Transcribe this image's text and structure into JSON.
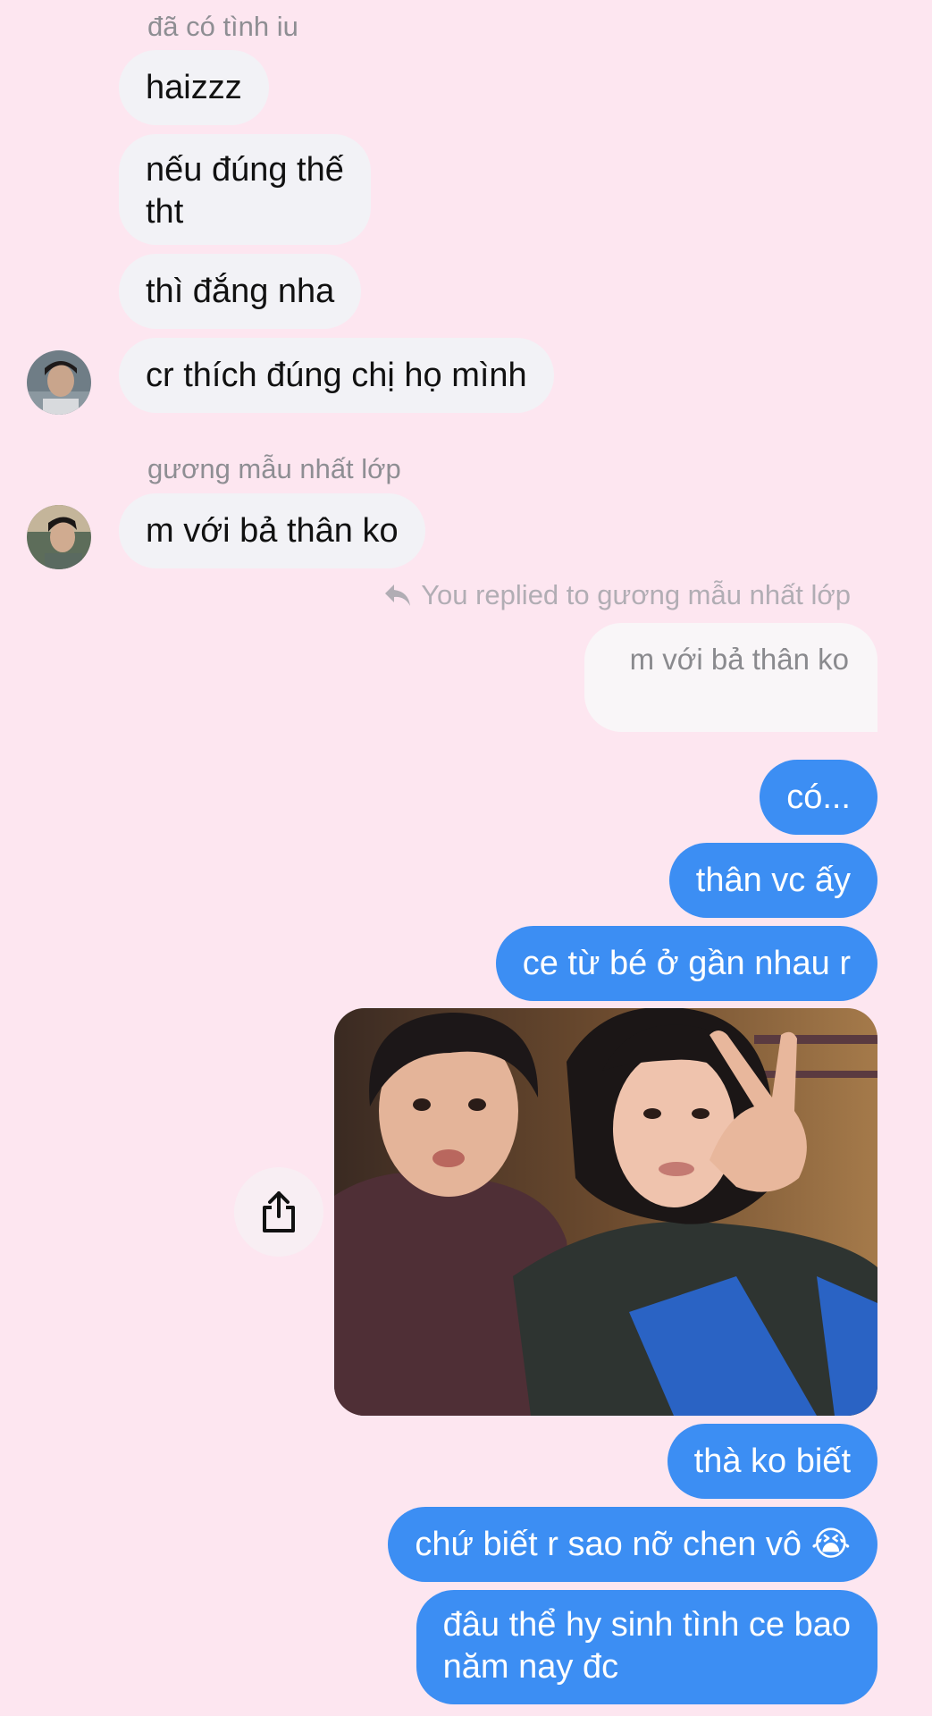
{
  "conversation": {
    "group_a": {
      "sender": "đã có tình iu",
      "messages": [
        "haizzz",
        "nếu đúng thế\ntht",
        "thì đắng nha",
        "cr thích đúng chị họ mình"
      ]
    },
    "group_b": {
      "sender": "gương mẫu nhất lớp",
      "messages": [
        "m với bả thân ko"
      ]
    },
    "reply": {
      "hint": "You replied to gương mẫu nhất lớp",
      "quoted": "m với bả thân ko"
    },
    "outgoing_top": [
      "có...",
      "thân vc ấy",
      "ce từ bé ở gần nhau r"
    ],
    "photo": {
      "description_icon": "share-icon"
    },
    "outgoing_bottom": [
      "thà ko biết",
      "chứ biết r sao nỡ chen vô 😭",
      "đâu thể hy sinh tình ce bao\nnăm nay đc"
    ]
  },
  "colors": {
    "background": "#fde6f0",
    "incoming_bubble": "#f2f2f6",
    "outgoing_bubble": "#3c8ef3"
  }
}
